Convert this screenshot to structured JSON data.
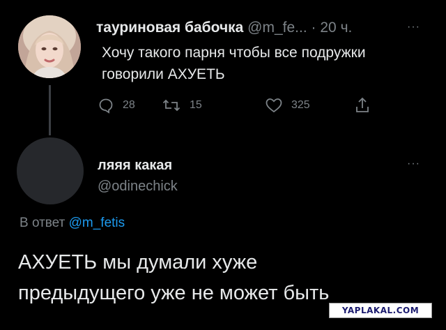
{
  "tweet1": {
    "display_name": "тауриновая бабочка",
    "handle": "@m_fe...",
    "separator": "·",
    "time": "20 ч.",
    "more_label": "···",
    "text_line1": "Хочу такого парня чтобы все подружки",
    "text_line2": "говорили АХУЕТЬ",
    "replies": "28",
    "retweets": "15",
    "likes": "325",
    "icons": [
      "reply-icon",
      "retweet-icon",
      "like-icon",
      "share-icon"
    ]
  },
  "tweet2": {
    "display_name": "ляяя какая",
    "handle": "@odinechick",
    "more_label": "···",
    "reply_prefix": "В ответ",
    "reply_to": "@m_fetis",
    "text_line1": "АХУЕТЬ мы думали хуже",
    "text_line2": "предыдущего уже не может быть"
  },
  "watermark": {
    "text": "YAPLAKAL.COM"
  },
  "colors": {
    "background": "#000000",
    "text": "#e7e9ea",
    "muted": "#7d8388",
    "link": "#1d9bf0"
  }
}
